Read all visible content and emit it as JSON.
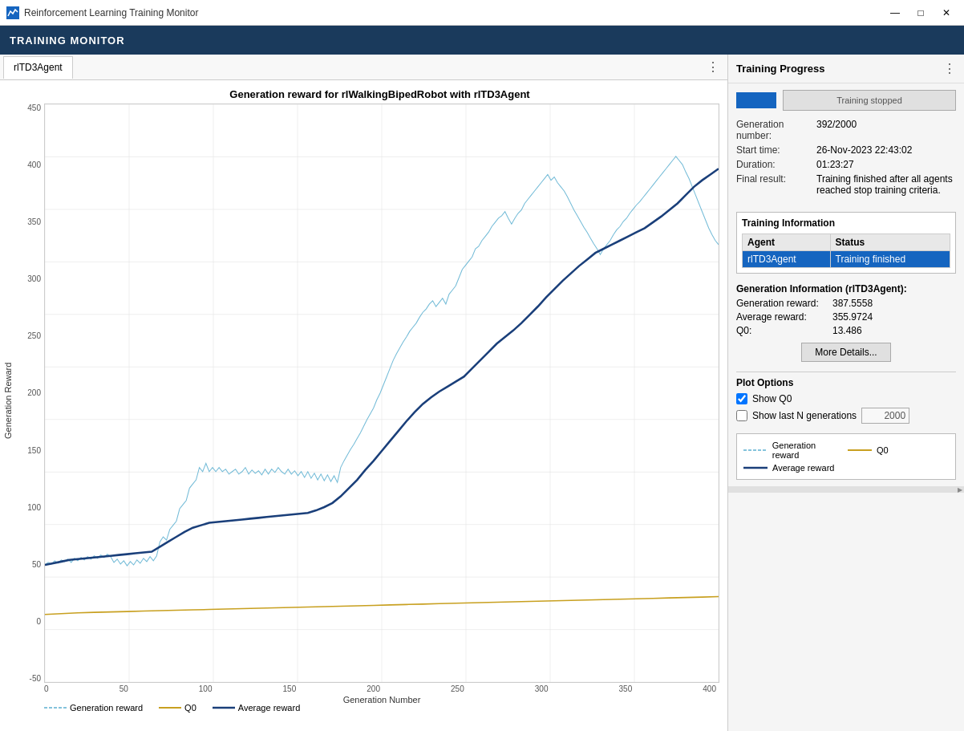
{
  "app": {
    "title": "Reinforcement Learning Training Monitor",
    "toolbar_title": "TRAINING MONITOR"
  },
  "tab": {
    "label": "rlTD3Agent"
  },
  "chart": {
    "title": "Generation reward for rlWalkingBipedRobot with rlTD3Agent",
    "y_axis_label": "Generation Reward",
    "x_axis_label": "Generation Number",
    "y_ticks": [
      "450",
      "400",
      "350",
      "300",
      "250",
      "200",
      "150",
      "100",
      "50",
      "0",
      "-50"
    ],
    "x_ticks": [
      "0",
      "50",
      "100",
      "150",
      "200",
      "250",
      "300",
      "350",
      "400"
    ]
  },
  "right_panel": {
    "header": "Training Progress",
    "stopped_label": "Training stopped",
    "generation_number_label": "Generation number:",
    "generation_number_value": "392/2000",
    "start_time_label": "Start time:",
    "start_time_value": "26-Nov-2023 22:43:02",
    "duration_label": "Duration:",
    "duration_value": "01:23:27",
    "final_result_label": "Final result:",
    "final_result_value": "Training finished after all agents reached stop training criteria."
  },
  "training_info": {
    "title": "Training Information",
    "agent_col": "Agent",
    "status_col": "Status",
    "agent_name": "rlTD3Agent",
    "agent_status": "Training finished"
  },
  "gen_info": {
    "title": "Generation Information (rlTD3Agent):",
    "gen_reward_label": "Generation reward:",
    "gen_reward_value": "387.5558",
    "avg_reward_label": "Average reward:",
    "avg_reward_value": "355.9724",
    "q0_label": "Q0:",
    "q0_value": "13.486",
    "more_details_label": "More Details..."
  },
  "plot_options": {
    "title": "Plot Options",
    "show_q0_label": "Show Q0",
    "show_last_label": "Show last N generations",
    "n_value": "2000"
  },
  "legend": {
    "gen_reward_label": "Generation reward",
    "avg_reward_label": "Average reward",
    "q0_label": "Q0"
  },
  "controls": {
    "minimize": "—",
    "maximize": "□",
    "close": "✕",
    "menu": "⋮"
  }
}
